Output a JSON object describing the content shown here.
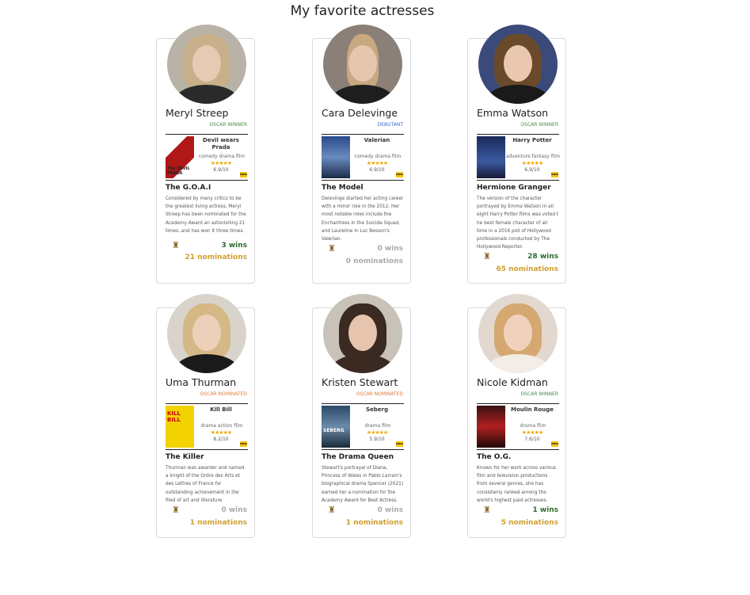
{
  "page": {
    "title": "My favorite actresses"
  },
  "colors": {
    "winner": "#4a8a4a",
    "nominated": "#e07a3a",
    "debutant": "#3a6ad0",
    "wins": "#2e6b2e",
    "nominations": "#d0a030",
    "stars": "#f0a800"
  },
  "actresses": [
    {
      "name": "Meryl Streep",
      "status": "OSCAR WINNER",
      "film": {
        "title": "Devil wears Prada",
        "genre": "comedy drama film",
        "stars": "★★★★★",
        "rating": "6.9/10",
        "poster_icon": "devil-wears-prada-poster",
        "poster_text": "The DEVIL PRADA"
      },
      "role": "The G.O.A.I",
      "description": "Considered by many critics to be the greatest living actress, Meryl Streep has been nominated for the Academy Award an astonishing 21 times, and has won it three times.",
      "wins": "3 wins",
      "nominations": "21 nominations"
    },
    {
      "name": "Cara Delevinge",
      "status": "DEBUTANT",
      "film": {
        "title": "Valerian",
        "genre": "comedy drama film",
        "stars": "★★★★★",
        "rating": "6.9/10",
        "poster_icon": "valerian-poster",
        "poster_text": ""
      },
      "role": "The Model",
      "description": "Delevinge started her acting career with a minor role in the 2012. Her most notable roles include the Enchantress in the Suicide Squad, and Laureline in Luc Besson's Valerian.",
      "wins": "0 wins",
      "nominations": "0 nominations"
    },
    {
      "name": "Emma Watson",
      "status": "OSCAR WINNER",
      "film": {
        "title": "Harry Potter",
        "genre": "adventure fantasy film",
        "stars": "★★★★★",
        "rating": "6.9/10",
        "poster_icon": "harry-potter-poster",
        "poster_text": ""
      },
      "role": "Hermione Granger",
      "description": "The version of the character portrayed by Emma Watson in all eight Harry Potter films was voted t he best female character of all time in a 2016 poll of Hollywood professionals conducted by The Hollywood Reporter.",
      "wins": "28 wins",
      "nominations": "65 nominations"
    },
    {
      "name": "Uma Thurman",
      "status": "OSCAR NOMINATED",
      "film": {
        "title": "Kill Bill",
        "genre": "drama action film",
        "stars": "★★★★★",
        "rating": "8.2/10",
        "poster_icon": "kill-bill-poster",
        "poster_text": "KILL BILL"
      },
      "role": "The Killer",
      "description": "Thurman was awarder and named a knight of the Ordre des Arts et des Lettres of France for outstanding achievement in the filed of art and literature",
      "wins": "0 wins",
      "nominations": "1 nominations"
    },
    {
      "name": "Kristen Stewart",
      "status": "OSCAR NOMINATED",
      "film": {
        "title": "Seberg",
        "genre": "drama film",
        "stars": "★★★★★",
        "rating": "5.9/10",
        "poster_icon": "seberg-poster",
        "poster_text": "SEBERG"
      },
      "role": "The Drama Queen",
      "description": "Stewart's portrayal of Diana, Princess of Wales in Pablo Larrain's biographical drama Spencer (2021) earned her a nomination for the Academy Award for Best Actress.",
      "wins": "0 wins",
      "nominations": "1 nominations"
    },
    {
      "name": "Nicole Kidman",
      "status": "OSCAR WINNER",
      "film": {
        "title": "Moulin Rouge",
        "genre": "drama film",
        "stars": "★★★★★",
        "rating": "7.6/10",
        "poster_icon": "moulin-rouge-poster",
        "poster_text": ""
      },
      "role": "The O.G.",
      "description": "Known for her work across various film and television productions from several genres, she has consistenly ranked among the world's highest paid actresses.",
      "wins": "1 wins",
      "nominations": "5 nominations"
    }
  ]
}
